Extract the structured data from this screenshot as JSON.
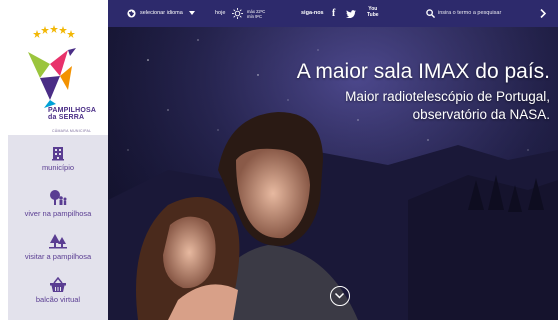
{
  "brand": {
    "name_line1": "PAMPILHOSA",
    "name_line2": "da SERRA",
    "subtitle": "CÂMARA MUNICIPAL"
  },
  "menu": {
    "items": [
      {
        "label": "município",
        "icon": "building-icon"
      },
      {
        "label": "viver na pampilhosa",
        "icon": "tree-people-icon"
      },
      {
        "label": "visitar a pampilhosa",
        "icon": "trees-icon"
      },
      {
        "label": "balcão virtual",
        "icon": "basket-icon"
      }
    ]
  },
  "topbar": {
    "language_label": "selecionar idioma",
    "today_label": "hoje",
    "temp_max": "máx 22ºC",
    "temp_min": "mín 9ºC",
    "follow_label": "siga-nos",
    "youtube_label_1": "You",
    "youtube_label_2": "Tube",
    "search_placeholder": "insira o termo a pesquisar"
  },
  "hero": {
    "headline": "A maior sala IMAX do país.",
    "subline_1": "Maior radiotelescópio de Portugal,",
    "subline_2": "observatório da NASA."
  },
  "colors": {
    "accent": "#5a3d92",
    "topbar": "#2d2a6c",
    "menu_bg": "#e3e2ec"
  }
}
